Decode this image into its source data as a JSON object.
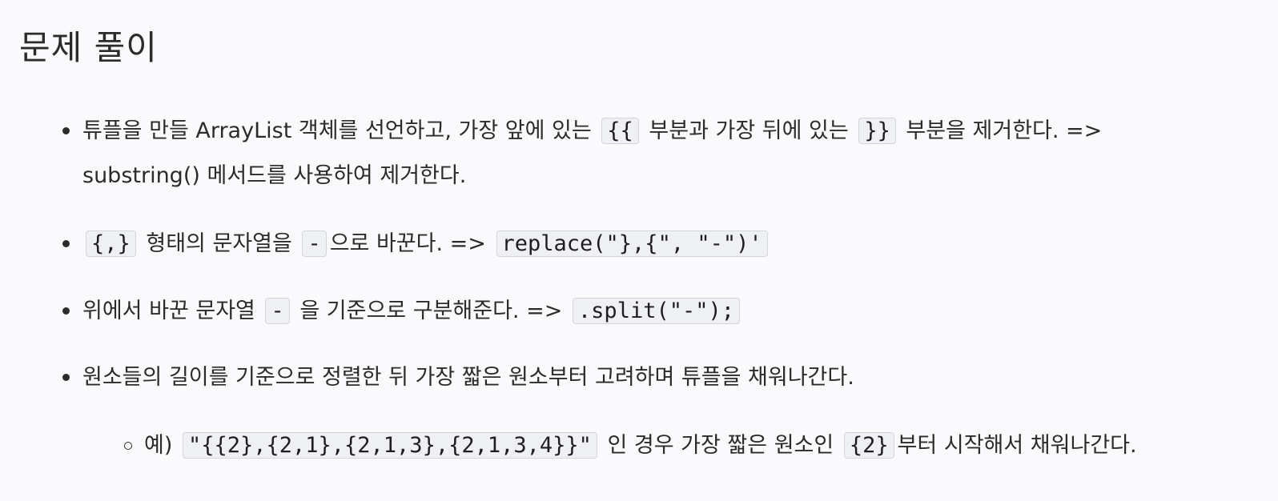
{
  "heading": "문제 풀이",
  "items": [
    {
      "line1_a": "튜플을 만들 ArrayList 객체를 선언하고, 가장 앞에 있는",
      "code1": "{{",
      "line1_b": "부분과 가장 뒤에 있는",
      "code2": "}}",
      "line1_c": "부분을 제거한다. =>",
      "line2": "substring() 메서드를 사용하여 제거한다."
    },
    {
      "code1": "{,}",
      "text_a": "형태의 문자열을",
      "code2": "-",
      "text_b": "으로 바꾼다. =>",
      "code3": "replace(\"},{\", \"-\")'"
    },
    {
      "text_a": "위에서 바꾼 문자열",
      "code1": "-",
      "text_b": "을 기준으로 구분해준다. =>",
      "code2": ".split(\"-\");"
    },
    {
      "text": "원소들의 길이를 기준으로 정렬한 뒤 가장 짧은 원소부터 고려하며 튜플을 채워나간다."
    }
  ],
  "subitem": {
    "text_a": "예)",
    "code1": "\"{{2},{2,1},{2,1,3},{2,1,3,4}}\"",
    "text_b": "인 경우 가장 짧은 원소인",
    "code2": "{2}",
    "text_c": "부터 시작해서 채워나간다."
  }
}
